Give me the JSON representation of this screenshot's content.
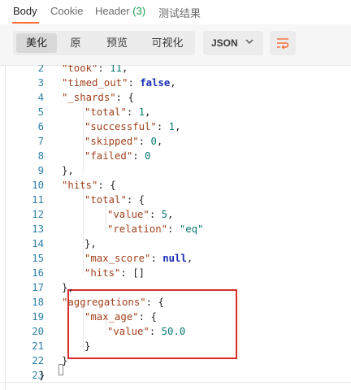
{
  "tabs": {
    "body": "Body",
    "cookie": "Cookie",
    "header": "Header",
    "header_count": "(3)",
    "tests": "测试结果"
  },
  "toolbar": {
    "pretty": "美化",
    "raw": "原",
    "preview": "预览",
    "visualize": "可视化",
    "format": "JSON"
  },
  "colors": {
    "accent": "#ff6c37",
    "highlight_border": "#d92b2b",
    "line_number": "#2c7fa6",
    "key": "#a0401c",
    "value": "#0a7a73",
    "keyword": "#1a2db3"
  },
  "lines": [
    {
      "n": "2",
      "t": "\"took\": 11,"
    },
    {
      "n": "3",
      "t": "\"timed_out\": false,"
    },
    {
      "n": "4",
      "t": "\"_shards\": {"
    },
    {
      "n": "5",
      "t": "\"total\": 1,"
    },
    {
      "n": "6",
      "t": "\"successful\": 1,"
    },
    {
      "n": "7",
      "t": "\"skipped\": 0,"
    },
    {
      "n": "8",
      "t": "\"failed\": 0"
    },
    {
      "n": "9",
      "t": "},"
    },
    {
      "n": "10",
      "t": "\"hits\": {"
    },
    {
      "n": "11",
      "t": "\"total\": {"
    },
    {
      "n": "12",
      "t": "\"value\": 5,"
    },
    {
      "n": "13",
      "t": "\"relation\": \"eq\""
    },
    {
      "n": "14",
      "t": "},"
    },
    {
      "n": "15",
      "t": "\"max_score\": null,"
    },
    {
      "n": "16",
      "t": "\"hits\": []"
    },
    {
      "n": "17",
      "t": "},"
    },
    {
      "n": "18",
      "t": "\"aggregations\": {"
    },
    {
      "n": "19",
      "t": "\"max_age\": {"
    },
    {
      "n": "20",
      "t": "\"value\": 50.0"
    },
    {
      "n": "21",
      "t": "}"
    },
    {
      "n": "22",
      "t": "}"
    },
    {
      "n": "23",
      "t": "}"
    }
  ]
}
